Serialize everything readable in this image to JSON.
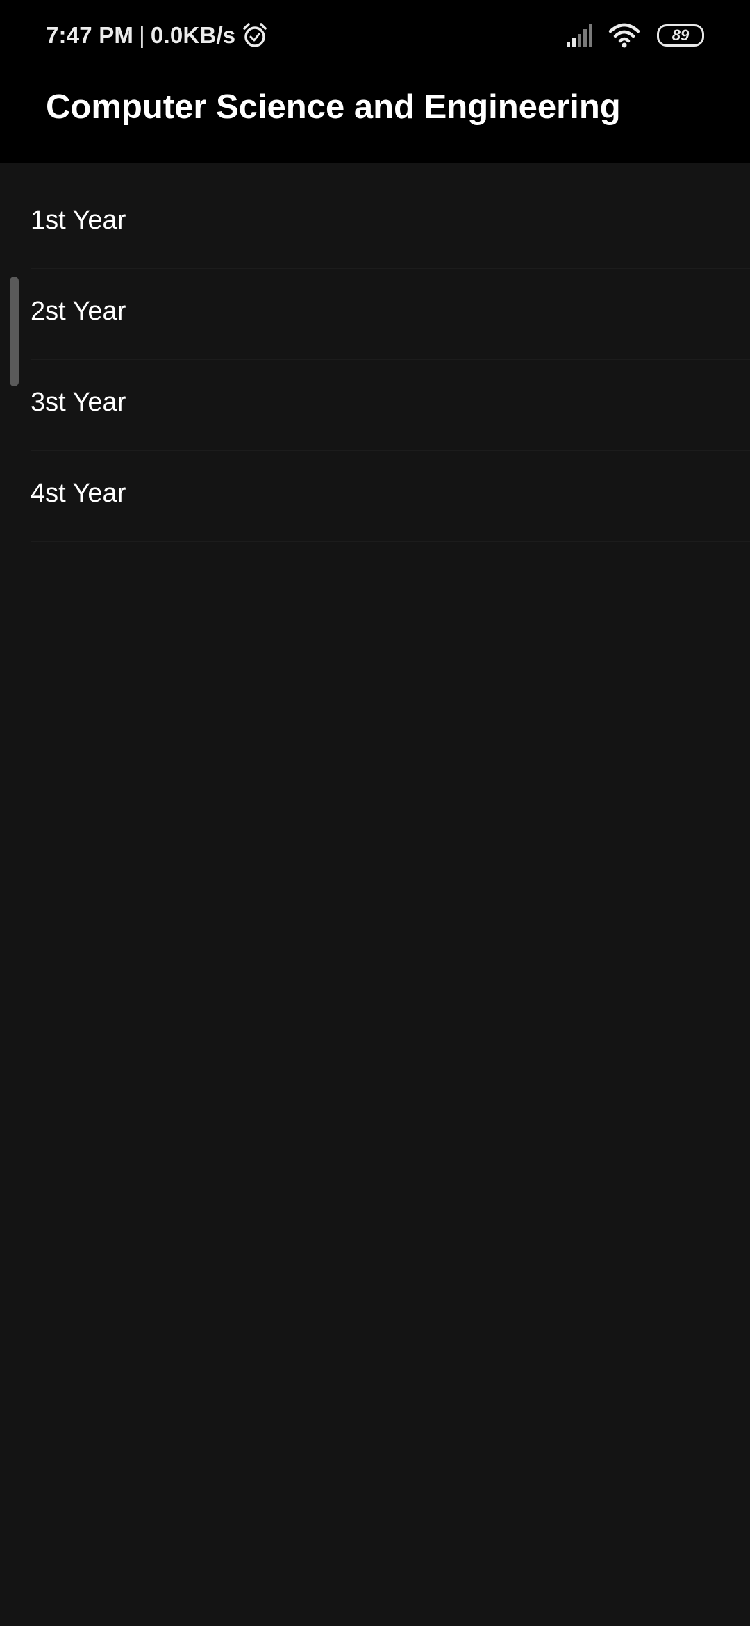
{
  "status_bar": {
    "time": "7:47 PM",
    "separator": "|",
    "speed": "0.0KB/s",
    "alarm_icon": "alarm-clock-icon",
    "signal_icon": "cell-signal-icon",
    "wifi_icon": "wifi-icon",
    "battery_level": "89"
  },
  "app_bar": {
    "title": "Computer Science and Engineering"
  },
  "list": {
    "items": [
      {
        "label": "1st Year"
      },
      {
        "label": "2st Year"
      },
      {
        "label": "3st Year"
      },
      {
        "label": "4st Year"
      }
    ]
  },
  "colors": {
    "background": "#141414",
    "app_bar": "#000000",
    "text": "#ffffff",
    "divider": "#1c1c1c",
    "scrollbar": "#5a5a5a"
  }
}
